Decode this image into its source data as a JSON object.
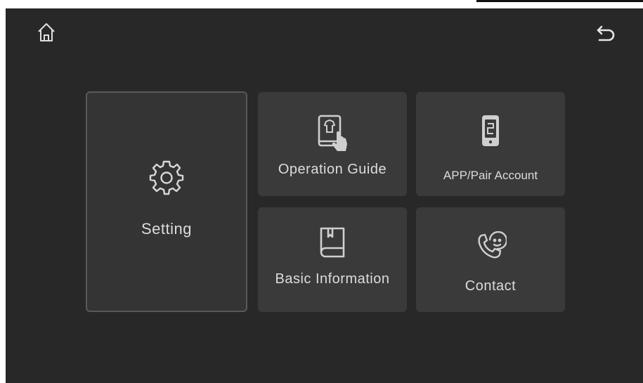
{
  "nav": {
    "home_icon": "home-icon",
    "back_icon": "back-arrow-icon"
  },
  "tiles": {
    "setting": {
      "label": "Setting",
      "icon": "gear-icon"
    },
    "operation_guide": {
      "label": "Operation Guide",
      "icon": "book-hand-touch-icon"
    },
    "app_pair": {
      "label": "APP/Pair Account",
      "icon": "phone-link-icon"
    },
    "basic_info": {
      "label": "Basic Information",
      "icon": "book-icon"
    },
    "contact": {
      "label": "Contact",
      "icon": "phone-smile-icon"
    }
  },
  "colors": {
    "background": "#282828",
    "tile": "#3a3a3a",
    "text": "#dcdcdc"
  }
}
